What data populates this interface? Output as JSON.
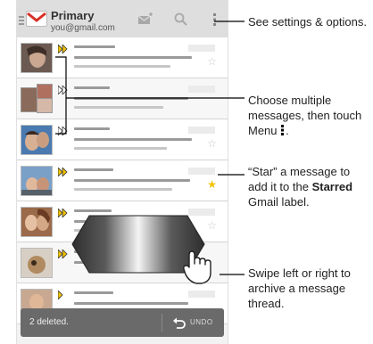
{
  "header": {
    "title": "Primary",
    "account": "you@gmail.com",
    "icons": [
      "menu-icon",
      "gmail-logo",
      "compose-icon",
      "search-icon",
      "overflow-menu-icon"
    ]
  },
  "messages": [
    {
      "sender_photo": "person-photo",
      "important": true,
      "unread": true,
      "starred": false
    },
    {
      "sender_photo": "two-people-photo",
      "important": true,
      "unread": false,
      "starred": false
    },
    {
      "sender_photo": "couple-photo",
      "important": true,
      "unread": true,
      "starred": false
    },
    {
      "sender_photo": "people-photo",
      "important": true,
      "unread": true,
      "starred": true
    },
    {
      "sender_photo": "couple-photo",
      "important": true,
      "unread": true,
      "starred": false
    },
    {
      "sender_photo": "dog-photo",
      "important": true,
      "unread": false,
      "starred": false
    },
    {
      "sender_photo": "person-photo",
      "important": true,
      "unread": true,
      "starred": false
    }
  ],
  "undo_bar": {
    "message": "2 deleted.",
    "undo_label": "UNDO"
  },
  "callouts": {
    "settings": "See settings & options.",
    "multi_select_prefix": "Choose multiple messages, then touch Menu",
    "star_prefix": "“Star” a message to add it to the",
    "star_bold": "Starred",
    "star_suffix": "Gmail label.",
    "swipe": "Swipe left or right to archive a message thread."
  },
  "colors": {
    "star_on": "#f2c200",
    "important_marker": "#f2c200",
    "selection": "#4b8bd3"
  }
}
